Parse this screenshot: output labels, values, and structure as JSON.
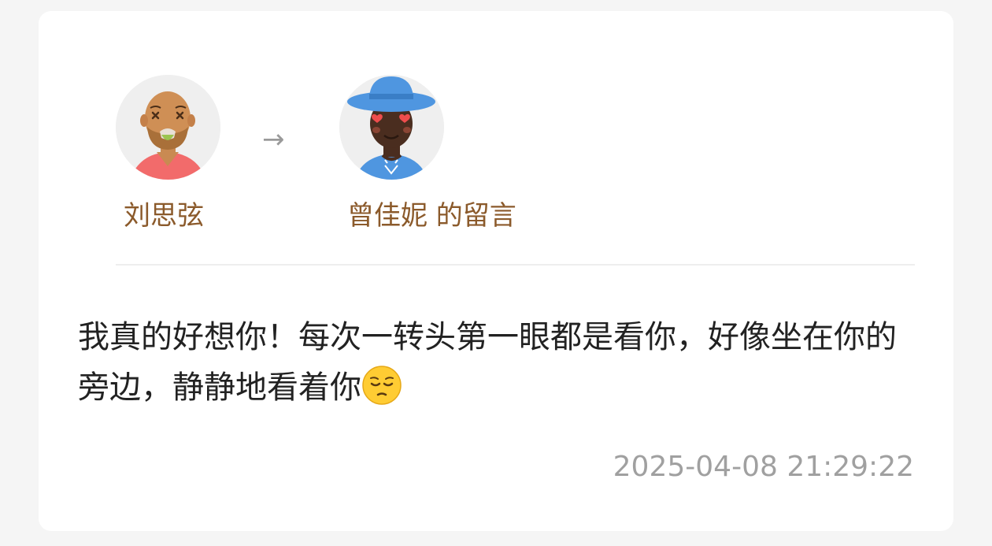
{
  "sender": {
    "name": "刘思弦",
    "avatar_icon": "bald-man-avatar-icon"
  },
  "arrow": "→",
  "receiver": {
    "name": "曾佳妮",
    "suffix": " 的留言",
    "avatar_icon": "man-with-blue-hat-avatar-icon"
  },
  "message": {
    "text": "我真的好想你！每次一转头第一眼都是看你，好像坐在你的旁边，静静地看着你",
    "emoji_icon": "pensive-face-emoji-icon"
  },
  "timestamp": "2025-04-08 21:29:22",
  "colors": {
    "name": "#8b5a2b",
    "text": "#222222",
    "timestamp": "#a0a0a0",
    "background": "#f5f5f5"
  }
}
